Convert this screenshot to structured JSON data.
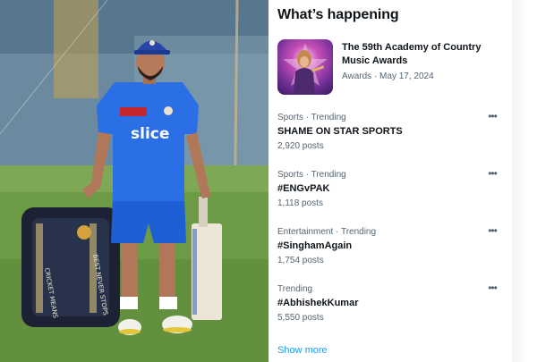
{
  "photo": {
    "description_icon": "cricketer-photo",
    "jersey_text": "slice"
  },
  "panel": {
    "title": "What’s happening",
    "featured": {
      "title": "The 59th Academy of Country Music Awards",
      "meta": "Awards · May 17, 2024"
    },
    "trends": [
      {
        "context": "Sports · Trending",
        "name": "SHAME ON STAR SPORTS",
        "count": "2,920 posts"
      },
      {
        "context": "Sports · Trending",
        "name": "#ENGvPAK",
        "count": "1,118 posts"
      },
      {
        "context": "Entertainment · Trending",
        "name": "#SinghamAgain",
        "count": "1,754 posts"
      },
      {
        "context": "Trending",
        "name": "#AbhishekKumar",
        "count": "5,550 posts"
      }
    ],
    "more_glyph": "•••",
    "show_more": "Show more"
  },
  "colors": {
    "text_primary": "#0f1419",
    "text_secondary": "#536471",
    "link": "#1d9bf0",
    "jersey_blue": "#1f5fd6"
  }
}
